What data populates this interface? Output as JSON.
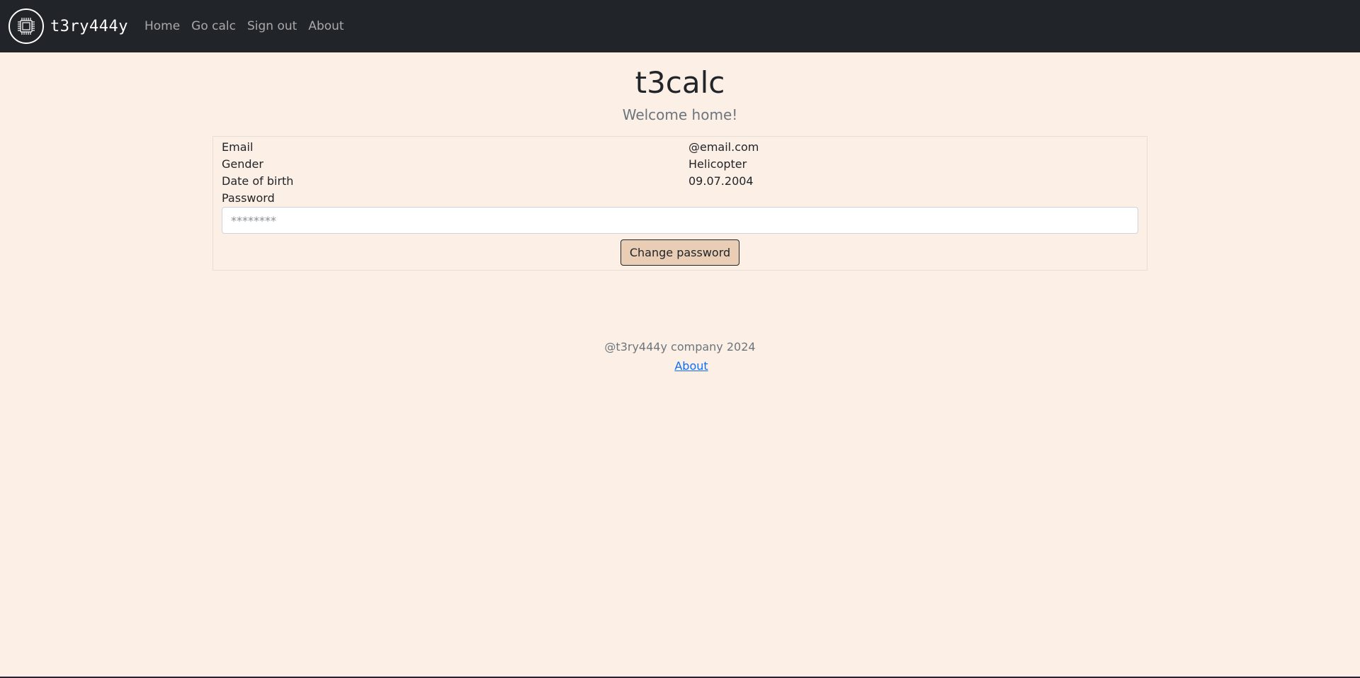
{
  "navbar": {
    "brand": "t3ry444y",
    "logo_icon": "chip-icon",
    "links": [
      "Home",
      "Go calc",
      "Sign out",
      "About"
    ]
  },
  "main": {
    "title": "t3calc",
    "subtitle": "Welcome home!"
  },
  "profile": {
    "rows": [
      {
        "label": "Email",
        "value": "@email.com"
      },
      {
        "label": "Gender",
        "value": "Helicopter"
      },
      {
        "label": "Date of birth",
        "value": "09.07.2004"
      }
    ],
    "password_label": "Password",
    "password_placeholder": "********",
    "change_password_label": "Change password"
  },
  "footer": {
    "text": "@t3ry444y company 2024",
    "link": "About"
  },
  "colors": {
    "background": "#fcefe6",
    "navbar": "#212529",
    "button": "#e9cdb4",
    "link": "#0d6efd"
  }
}
